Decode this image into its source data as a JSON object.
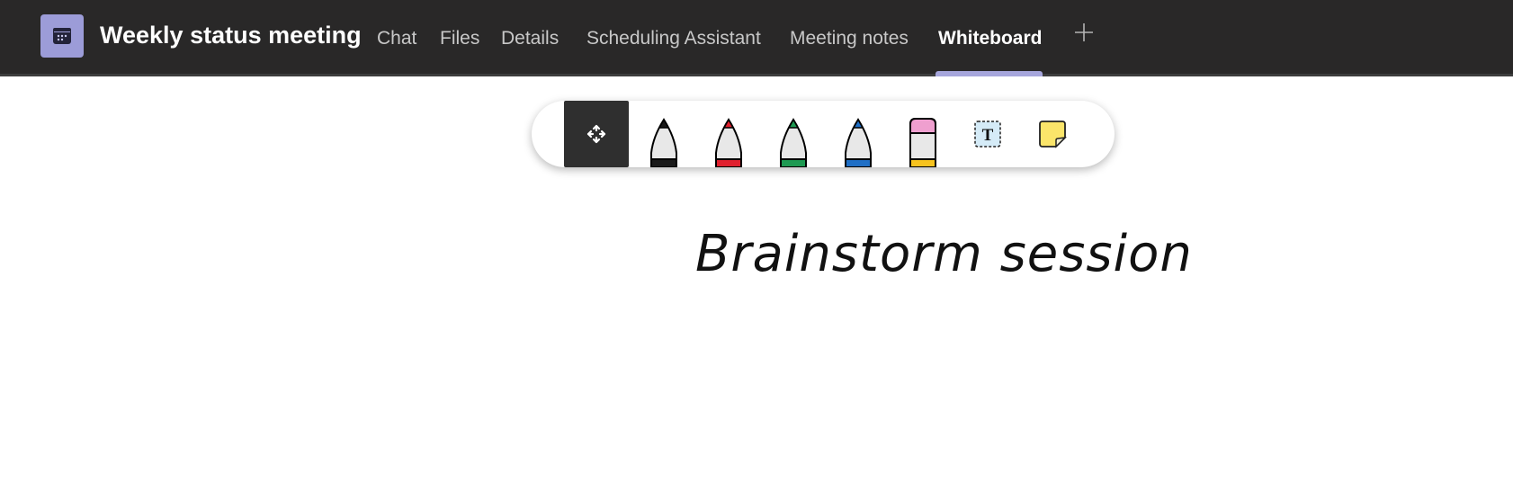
{
  "header": {
    "app_icon": "calendar-icon",
    "title": "Weekly status meeting",
    "tabs": [
      {
        "label": "Chat",
        "active": false
      },
      {
        "label": "Files",
        "active": false
      },
      {
        "label": "Details",
        "active": false
      },
      {
        "label": "Scheduling Assistant",
        "active": false
      },
      {
        "label": "Meeting notes",
        "active": false
      },
      {
        "label": "Whiteboard",
        "active": true
      }
    ],
    "add_tab_icon": "plus-icon",
    "accent_color": "#a6a6dc"
  },
  "toolbar": {
    "tools": [
      {
        "name": "move",
        "icon": "move-arrows-icon",
        "selected": true
      },
      {
        "name": "black-pen",
        "icon": "pen-icon",
        "color": "#1a1a1a"
      },
      {
        "name": "red-pen",
        "icon": "pen-icon",
        "color": "#e0202e"
      },
      {
        "name": "green-pen",
        "icon": "pen-icon",
        "color": "#1e9a52"
      },
      {
        "name": "blue-pen",
        "icon": "pen-icon",
        "color": "#1f6fc6"
      },
      {
        "name": "eraser",
        "icon": "eraser-icon"
      },
      {
        "name": "text",
        "icon": "text-box-icon",
        "glyph": "T"
      },
      {
        "name": "sticky-note",
        "icon": "sticky-note-icon"
      }
    ]
  },
  "canvas": {
    "text": "Brainstorm session"
  }
}
